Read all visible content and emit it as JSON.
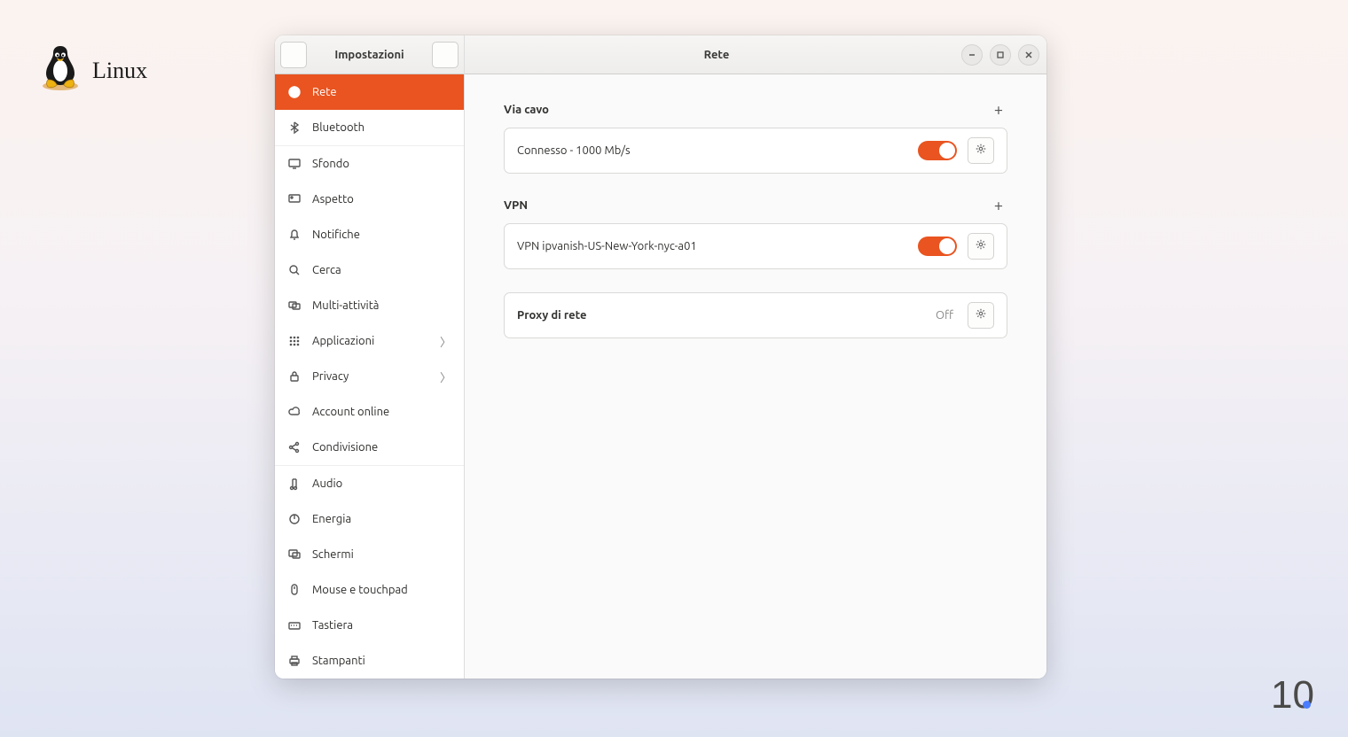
{
  "brand": {
    "label": "Linux"
  },
  "sidebar": {
    "title": "Impostazioni",
    "items": [
      {
        "label": "Rete"
      },
      {
        "label": "Bluetooth"
      },
      {
        "label": "Sfondo"
      },
      {
        "label": "Aspetto"
      },
      {
        "label": "Notifiche"
      },
      {
        "label": "Cerca"
      },
      {
        "label": "Multi-attività"
      },
      {
        "label": "Applicazioni"
      },
      {
        "label": "Privacy"
      },
      {
        "label": "Account online"
      },
      {
        "label": "Condivisione"
      },
      {
        "label": "Audio"
      },
      {
        "label": "Energia"
      },
      {
        "label": "Schermi"
      },
      {
        "label": "Mouse e touchpad"
      },
      {
        "label": "Tastiera"
      },
      {
        "label": "Stampanti"
      }
    ]
  },
  "main": {
    "title": "Rete",
    "wired": {
      "heading": "Via cavo",
      "status": "Connesso - 1000 Mb/s"
    },
    "vpn": {
      "heading": "VPN",
      "name": "VPN ipvanish-US-New-York-nyc-a01"
    },
    "proxy": {
      "heading": "Proxy di rete",
      "status": "Off"
    }
  },
  "corner": {
    "text": "10"
  }
}
